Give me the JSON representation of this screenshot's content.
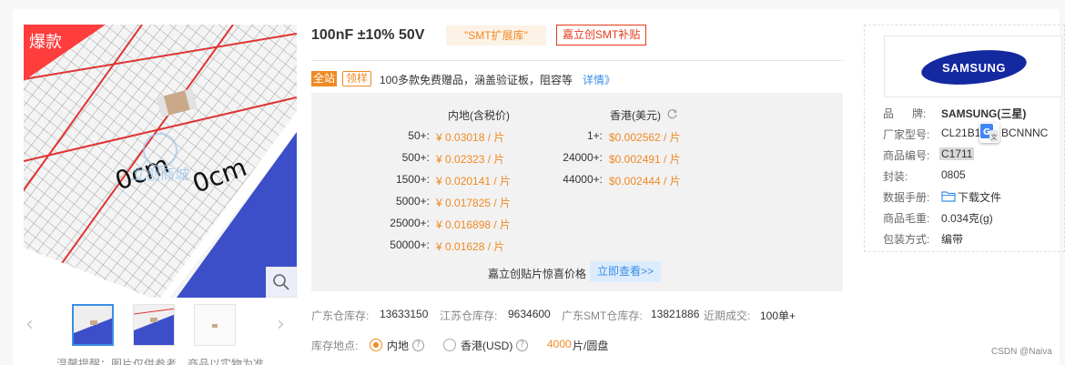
{
  "gallery": {
    "hot_badge": "爆款",
    "zoom_icon": "search-icon",
    "prev_icon": "chevron-left-icon",
    "next_icon": "chevron-right-icon",
    "thumbnail_count": 3,
    "selected_thumbnail": 1,
    "tip": "温馨提醒：图片仅供参考，商品以实物为准"
  },
  "product": {
    "title": "100nF ±10% 50V",
    "tag_ext": "\"SMT扩展库\"",
    "tag_subsidy": "嘉立创SMT补贴"
  },
  "promo": {
    "badge_all": "全站",
    "badge_get": "领样",
    "text": "100多款免费赠品，涵盖验证板，阻容等",
    "link": "详情》"
  },
  "pricing": {
    "mainland": {
      "header": "内地(含税价)",
      "rows": [
        {
          "qty": "50+:",
          "price": "¥ 0.03018 / 片"
        },
        {
          "qty": "500+:",
          "price": "¥ 0.02323 / 片"
        },
        {
          "qty": "1500+:",
          "price": "¥ 0.020141 / 片"
        },
        {
          "qty": "5000+:",
          "price": "¥ 0.017825 / 片"
        },
        {
          "qty": "25000+:",
          "price": "¥ 0.016898 / 片"
        },
        {
          "qty": "50000+:",
          "price": "¥ 0.01628 / 片"
        }
      ]
    },
    "hongkong": {
      "header": "香港(美元)",
      "header_icon": "refresh-icon",
      "rows": [
        {
          "qty": "1+:",
          "price": "$0.002562 / 片"
        },
        {
          "qty": "24000+:",
          "price": "$0.002491 / 片"
        },
        {
          "qty": "44000+:",
          "price": "$0.002444 / 片"
        }
      ]
    },
    "surprise_label": "嘉立创贴片惊喜价格",
    "surprise_button": "立即查看>>"
  },
  "stock": {
    "gd_label": "广东仓库存:",
    "gd_value": "13633150",
    "js_label": "江苏仓库存:",
    "js_value": "9634600",
    "smt_label": "广东SMT仓库存:",
    "smt_value": "13821886",
    "recent_label": "近期成交:",
    "recent_value": "100单+"
  },
  "location": {
    "label": "库存地点:",
    "option_mainland": "内地",
    "option_hk": "香港(USD)",
    "selected": "mainland",
    "pack_qty": "4000",
    "pack_unit": "片/圆盘"
  },
  "brand": {
    "logo_text": "SAMSUNG",
    "logo_color": "#1428a0",
    "specs": {
      "brand_label": "品      牌:",
      "brand_value": "SAMSUNG(三星)",
      "mfr_pn_label": "厂家型号:",
      "mfr_pn_value_a": "CL21B1",
      "mfr_pn_value_b": "BCNNNC",
      "translate_icon": "google-translate-icon",
      "code_label": "商品编号:",
      "code_value": "C1711",
      "package_label": "封装:",
      "package_value": "0805",
      "datasheet_label": "数据手册:",
      "datasheet_icon": "folder-icon",
      "datasheet_value": "下载文件",
      "weight_label": "商品毛重:",
      "weight_value": "0.034克(g)",
      "packing_label": "包装方式:",
      "packing_value": "编带"
    }
  },
  "watermark": "CSDN @Naiva",
  "colors": {
    "accent_orange": "#f08a24",
    "link_blue": "#3a8ee6",
    "hot_red": "#ff3d3d",
    "subsidy_red": "#e6391a",
    "price_panel_bg": "#f2f2f2"
  }
}
